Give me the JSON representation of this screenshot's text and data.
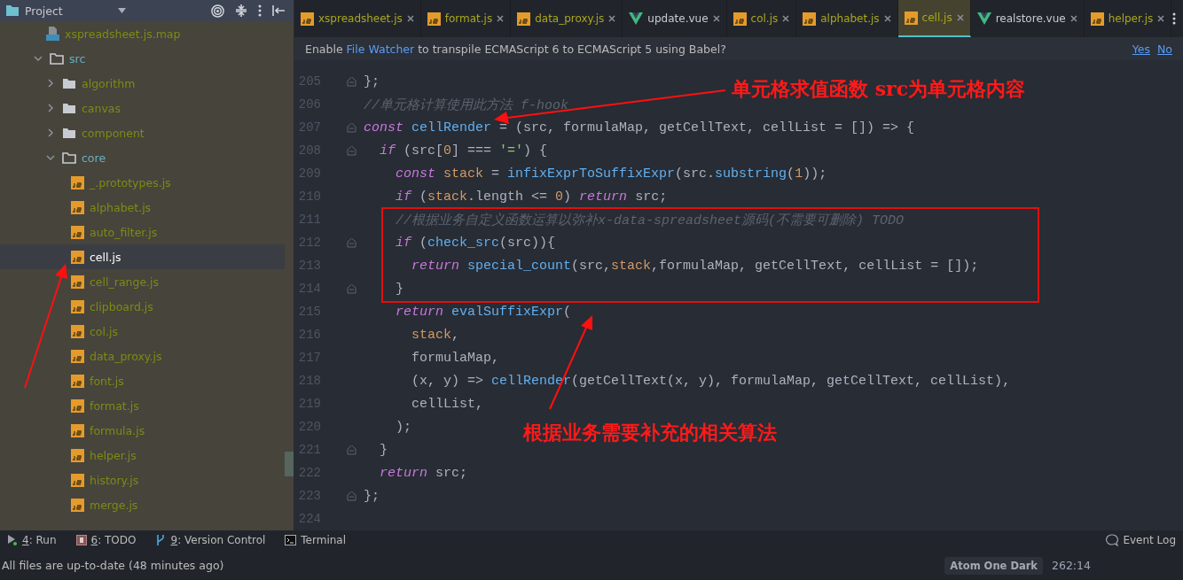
{
  "sidebar": {
    "title": "Project",
    "tree": [
      {
        "name": "xspreadsheet.js.map",
        "kind": "json",
        "color": "#7d8b14"
      },
      {
        "name": "src",
        "kind": "folder",
        "expanded": true,
        "color": "#68b0c2",
        "children": [
          {
            "name": "algorithm",
            "kind": "folder",
            "expanded": false,
            "color": "#7d8b14"
          },
          {
            "name": "canvas",
            "kind": "folder",
            "expanded": false,
            "color": "#7d8b14"
          },
          {
            "name": "component",
            "kind": "folder",
            "expanded": false,
            "color": "#7d8b14"
          },
          {
            "name": "core",
            "kind": "folder",
            "expanded": true,
            "color": "#68b0c2",
            "children": [
              {
                "name": "_.prototypes.js",
                "kind": "js",
                "selected": false,
                "color": "#7d8b14"
              },
              {
                "name": "alphabet.js",
                "kind": "js",
                "selected": false,
                "color": "#7d8b14"
              },
              {
                "name": "auto_filter.js",
                "kind": "js",
                "selected": false,
                "color": "#7d8b14"
              },
              {
                "name": "cell.js",
                "kind": "js",
                "selected": true
              },
              {
                "name": "cell_range.js",
                "kind": "js",
                "selected": false,
                "color": "#7d8b14"
              },
              {
                "name": "clipboard.js",
                "kind": "js",
                "selected": false,
                "color": "#7d8b14"
              },
              {
                "name": "col.js",
                "kind": "js",
                "selected": false,
                "color": "#7d8b14"
              },
              {
                "name": "data_proxy.js",
                "kind": "js",
                "selected": false,
                "color": "#7d8b14"
              },
              {
                "name": "font.js",
                "kind": "js",
                "selected": false,
                "color": "#7d8b14"
              },
              {
                "name": "format.js",
                "kind": "js",
                "selected": false,
                "color": "#7d8b14"
              },
              {
                "name": "formula.js",
                "kind": "js",
                "selected": false,
                "color": "#7d8b14"
              },
              {
                "name": "helper.js",
                "kind": "js",
                "selected": false,
                "color": "#7d8b14"
              },
              {
                "name": "history.js",
                "kind": "js",
                "selected": false,
                "color": "#7d8b14"
              },
              {
                "name": "merge.js",
                "kind": "js",
                "selected": false,
                "color": "#7d8b14"
              }
            ]
          }
        ]
      }
    ]
  },
  "tabs": [
    {
      "label": "xspreadsheet.js",
      "kind": "js",
      "selected": false
    },
    {
      "label": "format.js",
      "kind": "js",
      "selected": false
    },
    {
      "label": "data_proxy.js",
      "kind": "js",
      "selected": false
    },
    {
      "label": "update.vue",
      "kind": "vue",
      "selected": false
    },
    {
      "label": "col.js",
      "kind": "js",
      "selected": false
    },
    {
      "label": "alphabet.js",
      "kind": "js",
      "selected": false
    },
    {
      "label": "cell.js",
      "kind": "js",
      "selected": true
    },
    {
      "label": "realstore.vue",
      "kind": "vue",
      "selected": false
    },
    {
      "label": "helper.js",
      "kind": "js",
      "selected": false
    }
  ],
  "banner": {
    "before": "Enable ",
    "link": "File Watcher",
    "after": " to transpile ECMAScript 6 to ECMAScript 5 using Babel?",
    "actions": [
      "Yes",
      "No"
    ]
  },
  "editor": {
    "lines": [
      {
        "number": "205",
        "fold": true,
        "tokens": [
          {
            "kind": "plain",
            "text": "};"
          }
        ]
      },
      {
        "number": "206",
        "fold": false,
        "tokens": [
          {
            "kind": "comment",
            "text": "//单元格计算使用此方法 f-hook"
          }
        ]
      },
      {
        "number": "207",
        "fold": true,
        "tokens": [
          {
            "kind": "keyword",
            "text": "const "
          },
          {
            "kind": "function",
            "text": "cellRender"
          },
          {
            "kind": "plain",
            "text": " = (src, formulaMap, getCellText, cellList = []) => {"
          }
        ]
      },
      {
        "number": "208",
        "fold": true,
        "tokens": [
          {
            "kind": "keyword",
            "text": "  if"
          },
          {
            "kind": "plain",
            "text": " (src["
          },
          {
            "kind": "number",
            "text": "0"
          },
          {
            "kind": "plain",
            "text": "] === "
          },
          {
            "kind": "string",
            "text": "'='"
          },
          {
            "kind": "plain",
            "text": ") {"
          }
        ]
      },
      {
        "number": "209",
        "fold": false,
        "tokens": [
          {
            "kind": "keyword",
            "text": "    const "
          },
          {
            "kind": "variable",
            "text": "stack"
          },
          {
            "kind": "plain",
            "text": " = "
          },
          {
            "kind": "function",
            "text": "infixExprToSuffixExpr"
          },
          {
            "kind": "plain",
            "text": "(src."
          },
          {
            "kind": "function",
            "text": "substring"
          },
          {
            "kind": "plain",
            "text": "("
          },
          {
            "kind": "number",
            "text": "1"
          },
          {
            "kind": "plain",
            "text": "));"
          }
        ]
      },
      {
        "number": "210",
        "fold": false,
        "tokens": [
          {
            "kind": "keyword",
            "text": "    if"
          },
          {
            "kind": "plain",
            "text": " ("
          },
          {
            "kind": "variable",
            "text": "stack"
          },
          {
            "kind": "plain",
            "text": ".length <= "
          },
          {
            "kind": "number",
            "text": "0"
          },
          {
            "kind": "plain",
            "text": ") "
          },
          {
            "kind": "keyword",
            "text": "return"
          },
          {
            "kind": "plain",
            "text": " src;"
          }
        ]
      },
      {
        "number": "211",
        "fold": false,
        "tokens": [
          {
            "kind": "comment",
            "text": "    //根据业务自定义函数运算以弥补x-data-spreadsheet源码(不需要可删除) TODO"
          }
        ]
      },
      {
        "number": "212",
        "fold": true,
        "tokens": [
          {
            "kind": "keyword",
            "text": "    if"
          },
          {
            "kind": "plain",
            "text": " ("
          },
          {
            "kind": "function",
            "text": "check_src"
          },
          {
            "kind": "plain",
            "text": "(src)){"
          }
        ]
      },
      {
        "number": "213",
        "fold": false,
        "tokens": [
          {
            "kind": "keyword",
            "text": "      return "
          },
          {
            "kind": "function",
            "text": "special_count"
          },
          {
            "kind": "plain",
            "text": "(src,"
          },
          {
            "kind": "variable",
            "text": "stack"
          },
          {
            "kind": "plain",
            "text": ",formulaMap, getCellText, cellList = []);"
          }
        ]
      },
      {
        "number": "214",
        "fold": true,
        "tokens": [
          {
            "kind": "plain",
            "text": "    }"
          }
        ]
      },
      {
        "number": "215",
        "fold": false,
        "tokens": [
          {
            "kind": "keyword",
            "text": "    return "
          },
          {
            "kind": "function",
            "text": "evalSuffixExpr"
          },
          {
            "kind": "plain",
            "text": "("
          }
        ]
      },
      {
        "number": "216",
        "fold": false,
        "tokens": [
          {
            "kind": "variable",
            "text": "      stack"
          },
          {
            "kind": "plain",
            "text": ","
          }
        ]
      },
      {
        "number": "217",
        "fold": false,
        "tokens": [
          {
            "kind": "plain",
            "text": "      formulaMap,"
          }
        ]
      },
      {
        "number": "218",
        "fold": false,
        "tokens": [
          {
            "kind": "plain",
            "text": "      (x, y) => "
          },
          {
            "kind": "function",
            "text": "cellRender"
          },
          {
            "kind": "plain",
            "text": "(getCellText(x, y), formulaMap, getCellText, cellList),"
          }
        ]
      },
      {
        "number": "219",
        "fold": false,
        "tokens": [
          {
            "kind": "plain",
            "text": "      cellList,"
          }
        ]
      },
      {
        "number": "220",
        "fold": false,
        "tokens": [
          {
            "kind": "plain",
            "text": "    );"
          }
        ]
      },
      {
        "number": "221",
        "fold": true,
        "tokens": [
          {
            "kind": "plain",
            "text": "  }"
          }
        ]
      },
      {
        "number": "222",
        "fold": false,
        "tokens": [
          {
            "kind": "keyword",
            "text": "  return"
          },
          {
            "kind": "plain",
            "text": " src;"
          }
        ]
      },
      {
        "number": "223",
        "fold": true,
        "tokens": [
          {
            "kind": "plain",
            "text": "};"
          }
        ]
      },
      {
        "number": "224",
        "fold": false
      }
    ]
  },
  "annotations": [
    {
      "text": "单元格求值函数 src为单元格内容"
    },
    {
      "text": "根据业务需要补充的相关算法"
    }
  ],
  "tool_windows": [
    {
      "key": "4",
      "label": ": Run",
      "kind": "run"
    },
    {
      "key": "6",
      "label": ": TODO",
      "kind": "todo"
    },
    {
      "key": "9",
      "label": ": Version Control",
      "kind": "vcs"
    },
    {
      "label": "Terminal",
      "kind": "terminal"
    }
  ],
  "event_log": "Event Log",
  "status": {
    "message": "All files are up-to-date (48 minutes ago)",
    "theme": "Atom One Dark",
    "position": "262:14"
  }
}
